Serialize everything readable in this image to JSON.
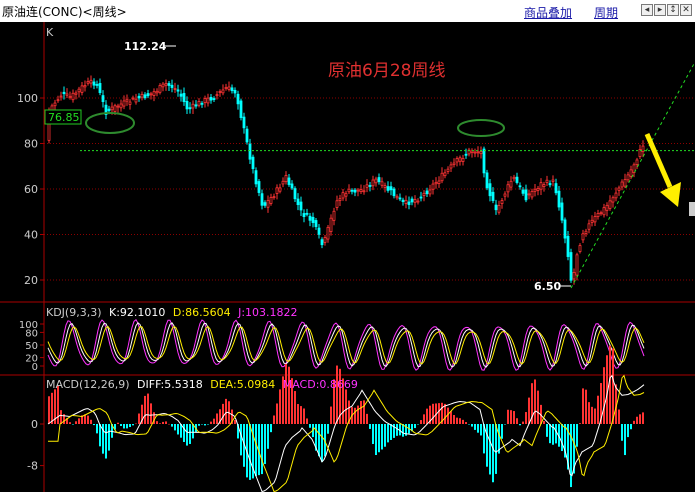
{
  "window": {
    "title": "原油连(CONC)<周线>",
    "menu": {
      "overlay": "商品叠加",
      "period": "周期"
    },
    "nav_icons": [
      "arrow-left-icon",
      "arrow-right-icon",
      "arrow-updown-icon",
      "close-icon"
    ]
  },
  "main_chart": {
    "indicator_label": "K",
    "annotation": "原油6月28周线",
    "high_label": "112.24",
    "low_label": "6.50",
    "price_tag": "76.85",
    "y_ticks": [
      "100",
      "80",
      "60",
      "40",
      "20"
    ],
    "colors": {
      "up": "#ff3333",
      "down": "#00ffff",
      "annotation": "#e03030",
      "ellipse": "#2e8b2e",
      "trend": "#22dd22",
      "arrow": "#ffee00"
    }
  },
  "kdj_panel": {
    "title": "KDJ(9,3,3)",
    "k_label": "K:92.1010",
    "d_label": "D:86.5604",
    "j_label": "J:103.1822",
    "y_ticks": [
      "100",
      "80",
      "50",
      "20",
      "0"
    ]
  },
  "macd_panel": {
    "title": "MACD(12,26,9)",
    "diff_label": "DIFF:5.5318",
    "dea_label": "DEA:5.0984",
    "macd_label": "MACD:0.8669",
    "y_ticks": [
      "0",
      "-8"
    ]
  }
}
